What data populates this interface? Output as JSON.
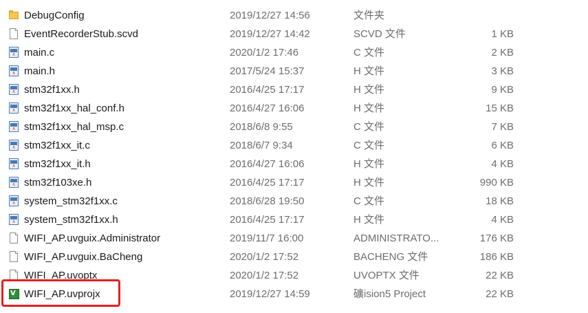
{
  "colors": {
    "highlight": "#e4201f",
    "folder": "#f6c54e",
    "source_icon": "#4a78b4",
    "project_icon": "#2f8f3a"
  },
  "files": [
    {
      "name": "DebugConfig",
      "date": "2019/12/27 14:56",
      "type": "文件夹",
      "size": "",
      "icon": "folder-icon"
    },
    {
      "name": "EventRecorderStub.scvd",
      "date": "2019/12/27 14:42",
      "type": "SCVD 文件",
      "size": "1 KB",
      "icon": "document-icon"
    },
    {
      "name": "main.c",
      "date": "2020/1/2 17:46",
      "type": "C 文件",
      "size": "2 KB",
      "icon": "source-file-icon"
    },
    {
      "name": "main.h",
      "date": "2017/5/24 15:37",
      "type": "H 文件",
      "size": "3 KB",
      "icon": "source-file-icon"
    },
    {
      "name": "stm32f1xx.h",
      "date": "2016/4/25 17:17",
      "type": "H 文件",
      "size": "9 KB",
      "icon": "source-file-icon"
    },
    {
      "name": "stm32f1xx_hal_conf.h",
      "date": "2016/4/27 16:06",
      "type": "H 文件",
      "size": "15 KB",
      "icon": "source-file-icon"
    },
    {
      "name": "stm32f1xx_hal_msp.c",
      "date": "2018/6/8 9:55",
      "type": "C 文件",
      "size": "7 KB",
      "icon": "source-file-icon"
    },
    {
      "name": "stm32f1xx_it.c",
      "date": "2018/6/7 9:34",
      "type": "C 文件",
      "size": "6 KB",
      "icon": "source-file-icon"
    },
    {
      "name": "stm32f1xx_it.h",
      "date": "2016/4/27 16:06",
      "type": "H 文件",
      "size": "4 KB",
      "icon": "source-file-icon"
    },
    {
      "name": "stm32f103xe.h",
      "date": "2016/4/25 17:17",
      "type": "H 文件",
      "size": "990 KB",
      "icon": "source-file-icon"
    },
    {
      "name": "system_stm32f1xx.c",
      "date": "2018/6/28 19:50",
      "type": "C 文件",
      "size": "18 KB",
      "icon": "source-file-icon"
    },
    {
      "name": "system_stm32f1xx.h",
      "date": "2016/4/25 17:17",
      "type": "H 文件",
      "size": "4 KB",
      "icon": "source-file-icon"
    },
    {
      "name": "WIFI_AP.uvguix.Administrator",
      "date": "2019/11/7 16:00",
      "type": "ADMINISTRATO...",
      "size": "176 KB",
      "icon": "document-icon"
    },
    {
      "name": "WIFI_AP.uvguix.BaCheng",
      "date": "2020/1/2 17:52",
      "type": "BACHENG 文件",
      "size": "186 KB",
      "icon": "document-icon"
    },
    {
      "name": "WIFI_AP.uvoptx",
      "date": "2020/1/2 17:52",
      "type": "UVOPTX 文件",
      "size": "22 KB",
      "icon": "document-icon"
    },
    {
      "name": "WIFI_AP.uvprojx",
      "date": "2019/12/27 14:59",
      "type": "礦ision5 Project",
      "size": "22 KB",
      "icon": "keil-project-icon"
    }
  ]
}
